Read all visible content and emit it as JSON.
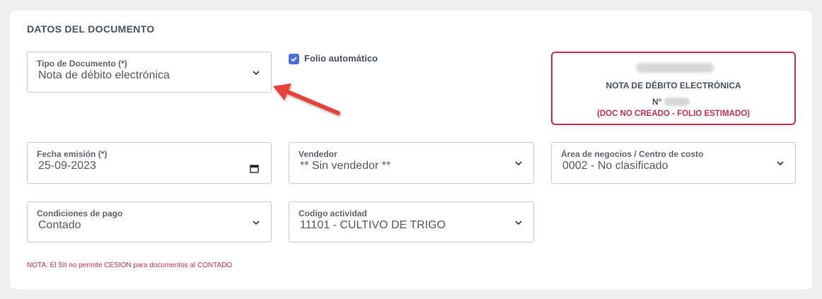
{
  "section": {
    "title": "DATOS DEL DOCUMENTO"
  },
  "fields": {
    "tipo_documento": {
      "label": "Tipo de Documento (*)",
      "value": "Nota de débito electrónica"
    },
    "fecha_emision": {
      "label": "Fecha emisión (*)",
      "value": "25-09-2023"
    },
    "vendedor": {
      "label": "Vendedor",
      "value": "** Sin vendedor **"
    },
    "area_negocios": {
      "label": "Área de negocios / Centro de costo",
      "value": "0002 - No clasificado"
    },
    "condiciones_pago": {
      "label": "Condiciones de pago",
      "value": "Contado"
    },
    "codigo_actividad": {
      "label": "Codigo actividad",
      "value": "11101 - CULTIVO DE TRIGO"
    }
  },
  "folio": {
    "label": "Folio automático",
    "checked": true
  },
  "doc_box": {
    "type": "NOTA DE DÉBITO ELECTRÓNICA",
    "number_prefix": "N°",
    "status": "(DOC NO CREADO - FOLIO ESTIMADO)"
  },
  "note": "NOTA: El SII no permite CESION para documentos al CONTADO",
  "colors": {
    "accent_red": "#c0304f",
    "checkbox_blue": "#4a6ed8",
    "arrow_red": "#e8413b"
  },
  "icons": [
    "chevron-down-icon",
    "calendar-icon",
    "checkmark-icon",
    "annotation-arrow"
  ]
}
